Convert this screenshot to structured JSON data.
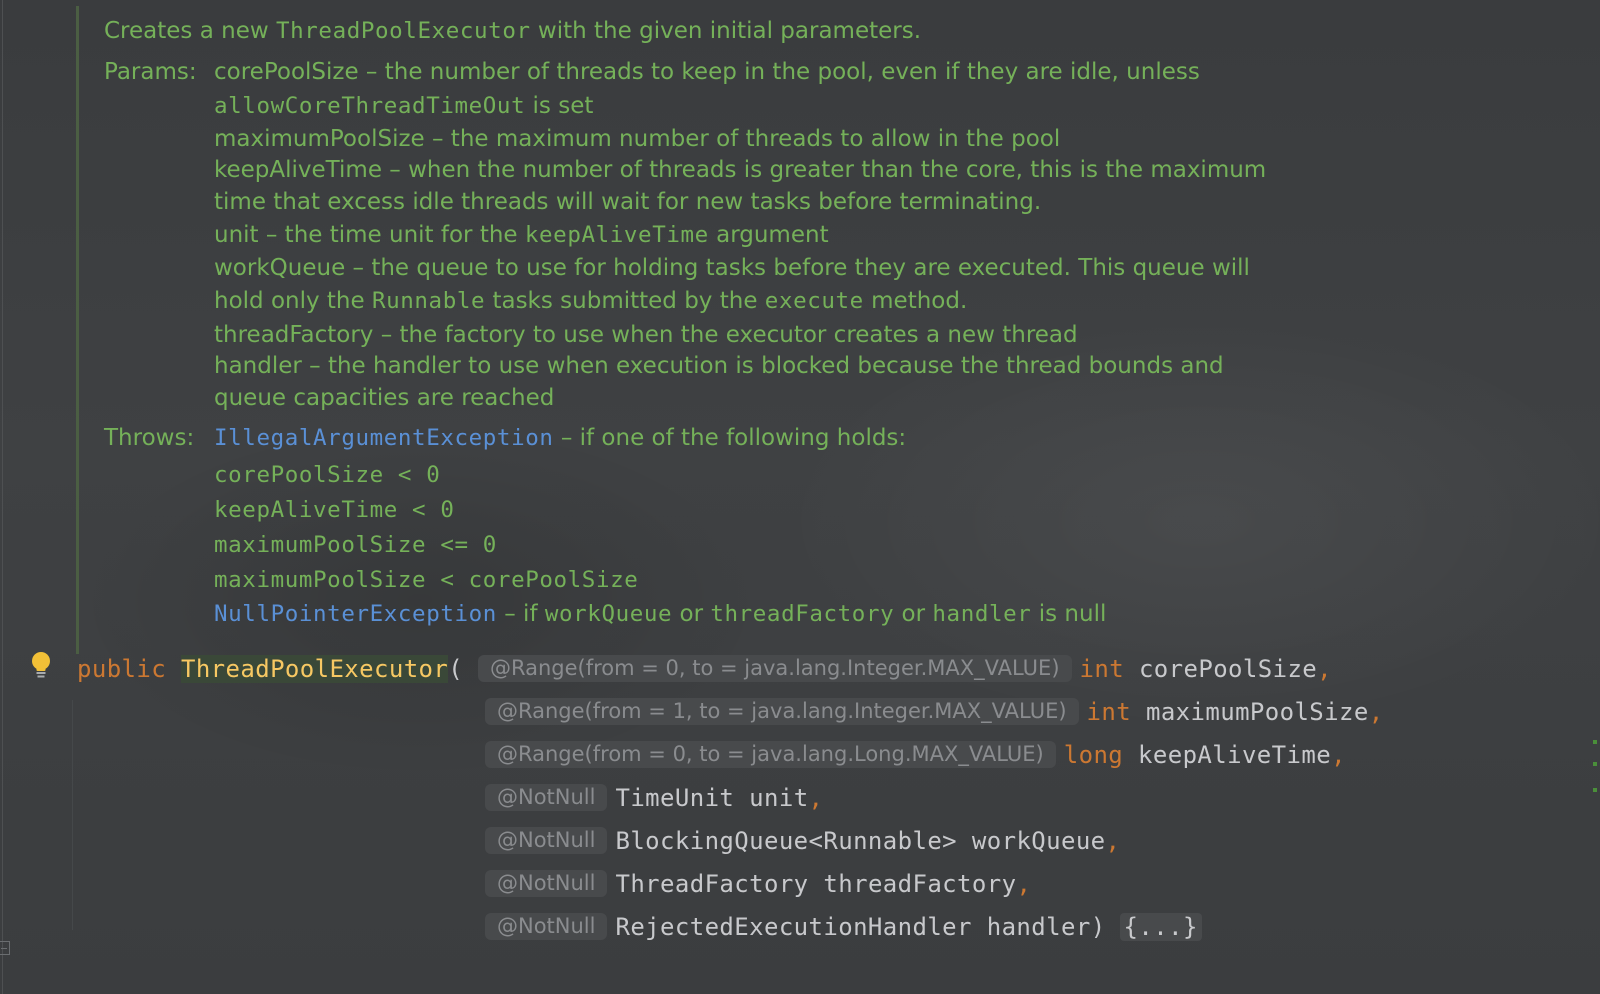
{
  "doc": {
    "summary_parts": [
      "Creates a new ",
      "ThreadPoolExecutor",
      " with the given initial parameters."
    ],
    "params_label": "Params:",
    "params": [
      [
        "corePoolSize – the number of threads to keep in the pool, even if they are idle, unless"
      ],
      [
        "",
        "allowCoreThreadTimeOut",
        " is set"
      ],
      [
        "maximumPoolSize – the maximum number of threads to allow in the pool"
      ],
      [
        "keepAliveTime – when the number of threads is greater than the core, this is the maximum"
      ],
      [
        "time that excess idle threads will wait for new tasks before terminating."
      ],
      [
        "unit – the time unit for the ",
        "keepAliveTime",
        " argument"
      ],
      [
        "workQueue – the queue to use for holding tasks before they are executed. This queue will"
      ],
      [
        "hold only the ",
        "Runnable",
        " tasks submitted by the ",
        "execute",
        " method."
      ],
      [
        "threadFactory – the factory to use when the executor creates a new thread"
      ],
      [
        "handler – the handler to use when execution is blocked because the thread bounds and"
      ],
      [
        "queue capacities are reached"
      ]
    ],
    "throws_label": "Throws:",
    "throws": {
      "exception1": "IllegalArgumentException",
      "exception1_text": " – if one of the following holds:",
      "conditions": [
        "corePoolSize < 0",
        "keepAliveTime < 0",
        "maximumPoolSize <= 0",
        "maximumPoolSize < corePoolSize"
      ],
      "exception2": "NullPointerException",
      "exception2_parts": [
        " – if ",
        "workQueue",
        " or ",
        "threadFactory",
        " or ",
        "handler",
        " is null"
      ]
    }
  },
  "code": {
    "modifier": "public",
    "method_name": "ThreadPoolExecutor",
    "open_paren": "(",
    "params": [
      {
        "annotation": "@Range(from = 0, to = java.lang.Integer.MAX_VALUE)",
        "type": "int",
        "type_is_keyword": true,
        "name": "corePoolSize",
        "trail": ","
      },
      {
        "annotation": "@Range(from = 1, to = java.lang.Integer.MAX_VALUE)",
        "type": "int",
        "type_is_keyword": true,
        "name": "maximumPoolSize",
        "trail": ","
      },
      {
        "annotation": "@Range(from = 0, to = java.lang.Long.MAX_VALUE)",
        "type": "long",
        "type_is_keyword": true,
        "name": "keepAliveTime",
        "trail": ","
      },
      {
        "annotation": "@NotNull",
        "type": "TimeUnit",
        "type_is_keyword": false,
        "name": "unit",
        "trail": ","
      },
      {
        "annotation": "@NotNull",
        "type": "BlockingQueue<Runnable>",
        "type_is_keyword": false,
        "name": "workQueue",
        "trail": ","
      },
      {
        "annotation": "@NotNull",
        "type": "ThreadFactory",
        "type_is_keyword": false,
        "name": "threadFactory",
        "trail": ","
      },
      {
        "annotation": "@NotNull",
        "type": "RejectedExecutionHandler",
        "type_is_keyword": false,
        "name": "handler",
        "trail": ")"
      }
    ],
    "folded_body": "{...}"
  },
  "icons": {
    "intention": "lightbulb-icon",
    "fold": "fold-collapse-icon"
  },
  "colors": {
    "background": "#3d3f41",
    "doc_text": "#75b159",
    "doc_link": "#5a90d6",
    "keyword": "#cc7832",
    "method_name": "#f7c863",
    "code_text": "#c8c9cc",
    "inlay_hint": "#8a8c8f"
  }
}
